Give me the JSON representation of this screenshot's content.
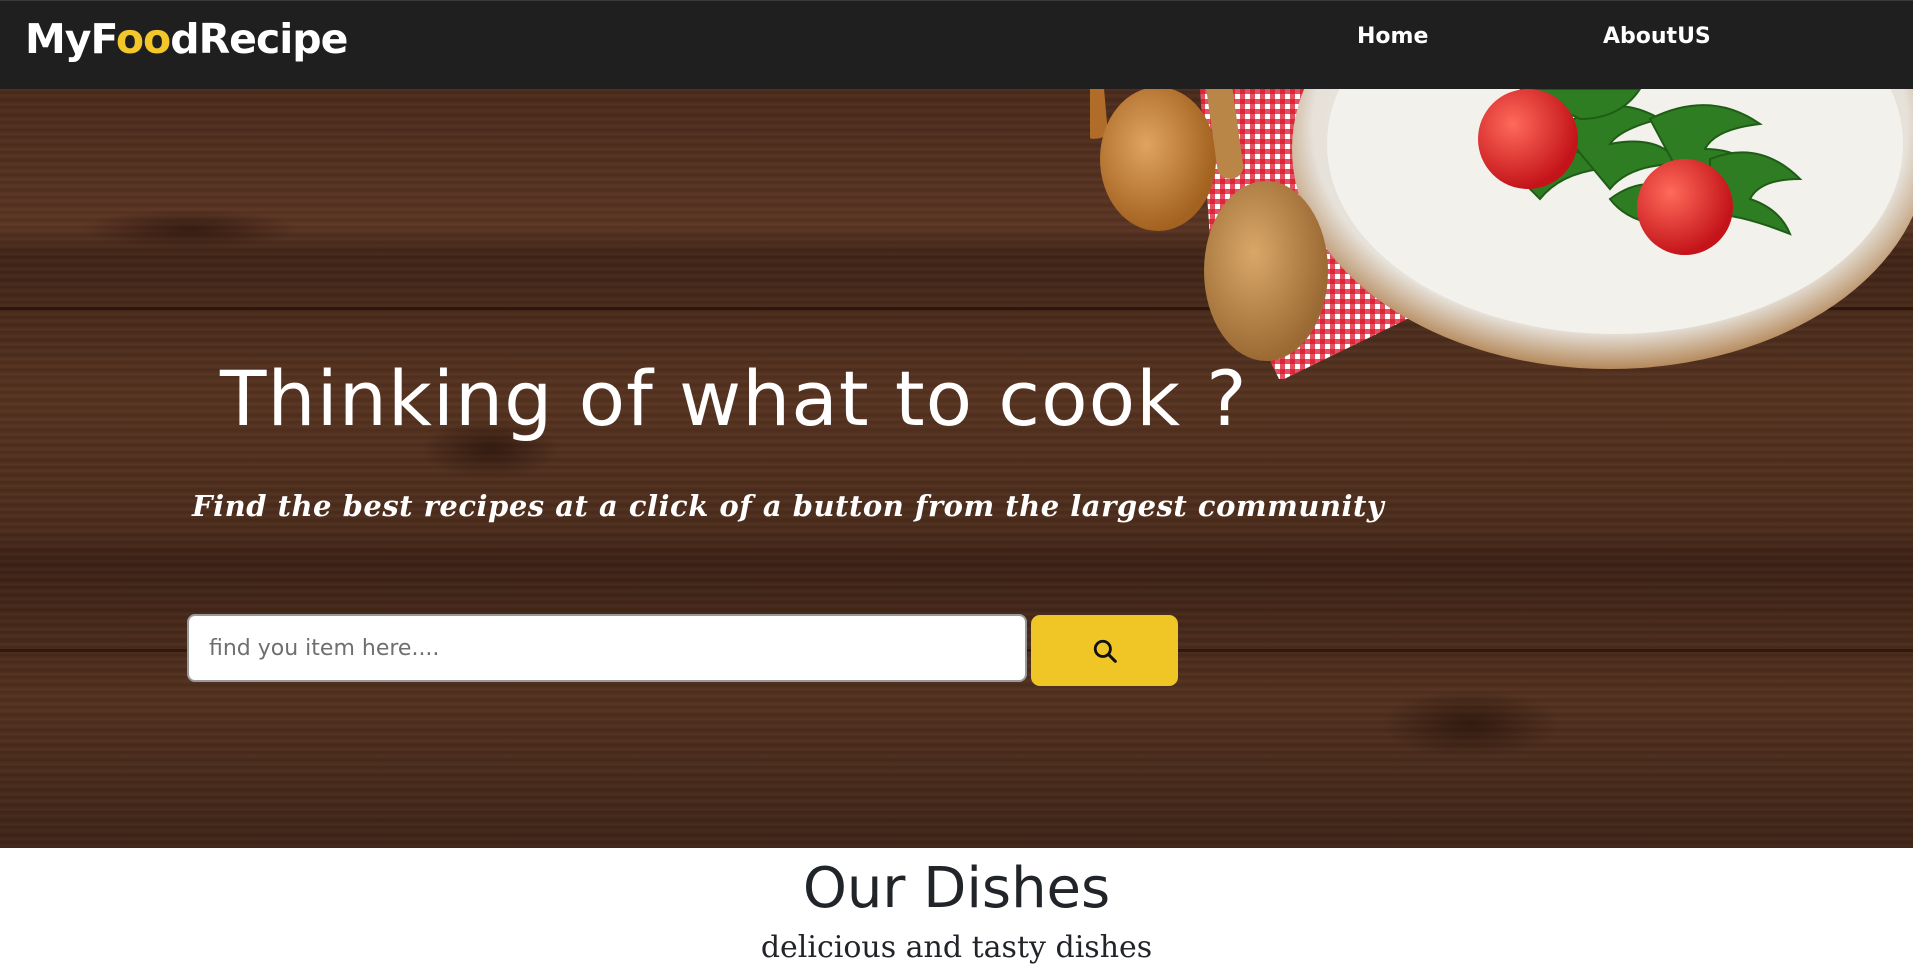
{
  "navbar": {
    "brand": {
      "part1": "MyF",
      "accent": "oo",
      "part2": "dRecipe"
    },
    "links": [
      {
        "label": "Home"
      },
      {
        "label": "AboutUS"
      }
    ]
  },
  "hero": {
    "title": "Thinking of what to cook ?",
    "subtitle": "Find the best recipes at a click of a button from the largest community",
    "search": {
      "placeholder": "find you item here....",
      "value": ""
    },
    "search_button_icon": "search-icon"
  },
  "dishes": {
    "title": "Our Dishes",
    "subtitle": "delicious and tasty dishes"
  },
  "colors": {
    "navbar_bg": "#1f1f1f",
    "accent": "#f2c72a",
    "search_button": "#f0c526",
    "text_dark": "#212529"
  }
}
